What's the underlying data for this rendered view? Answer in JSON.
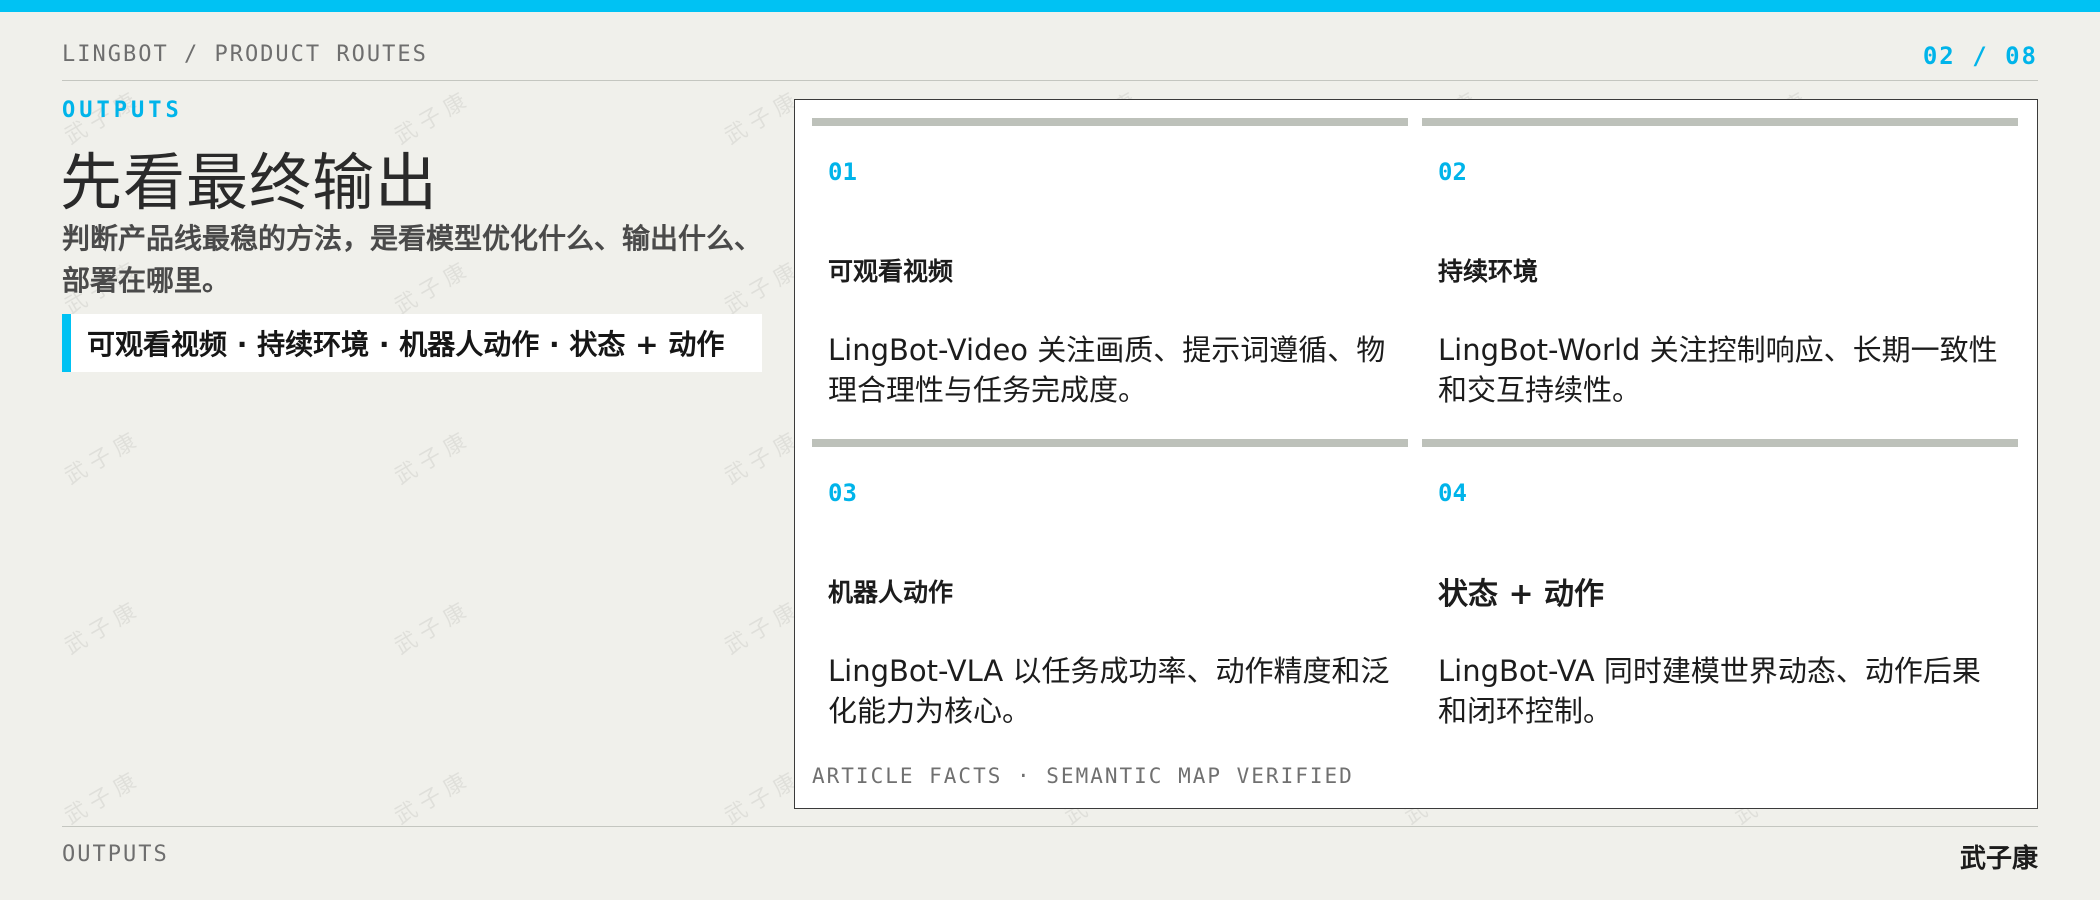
{
  "header": {
    "breadcrumb": "LINGBOT / PRODUCT ROUTES",
    "page_indicator": "02 / 08"
  },
  "intro": {
    "kicker": "OUTPUTS",
    "title": "先看最终输出",
    "subtitle": "判断产品线最稳的方法，是看模型优化什么、输出什么、部署在哪里。",
    "callout": "可观看视频 · 持续环境 · 机器人动作 · 状态 + 动作"
  },
  "cards": [
    {
      "number": "01",
      "name": "可观看视频",
      "description": "LingBot-Video 关注画质、提示词遵循、物理合理性与任务完成度。"
    },
    {
      "number": "02",
      "name": "持续环境",
      "description": "LingBot-World 关注控制响应、长期一致性和交互持续性。"
    },
    {
      "number": "03",
      "name": "机器人动作",
      "description": "LingBot-VLA 以任务成功率、动作精度和泛化能力为核心。"
    },
    {
      "number": "04",
      "name": "状态 + 动作",
      "description": "LingBot-VA 同时建模世界动态、动作后果和闭环控制。"
    }
  ],
  "panel_footer": "ARTICLE FACTS · SEMANTIC MAP VERIFIED",
  "footer": {
    "section": "OUTPUTS",
    "author": "武子康"
  },
  "watermark": "武子康",
  "colors": {
    "accent": "#00c2f3",
    "background": "#f0f0eb",
    "card_rule": "#bdc1ba"
  }
}
